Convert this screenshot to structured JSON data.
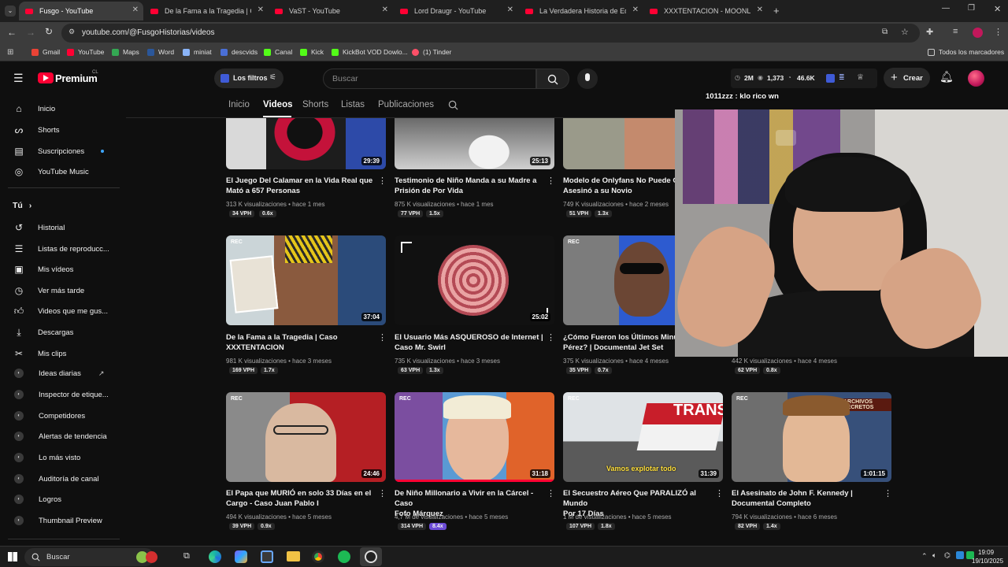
{
  "browser": {
    "tabs": [
      {
        "title": "Fusgo - YouTube",
        "active": true
      },
      {
        "title": "De la Fama a la Tragedia | Caso"
      },
      {
        "title": "VaST - YouTube"
      },
      {
        "title": "Lord Draugr - YouTube"
      },
      {
        "title": "La Verdadera Historia de Ed Ge"
      },
      {
        "title": "XXXTENTACION - MOONLIGHT"
      }
    ],
    "url": "youtube.com/@FusgoHistorias/videos",
    "bookmarks": [
      "Gmail",
      "YouTube",
      "Maps",
      "Word",
      "miniat",
      "descvids",
      "Canal",
      "Kick",
      "KickBot VOD Dowlo...",
      "(1) Tinder"
    ],
    "all_bookmarks": "Todos los marcadores"
  },
  "header": {
    "logo": "Premium",
    "country": "CL",
    "filters_label": "Los filtros",
    "search_placeholder": "Buscar",
    "stats": {
      "subs": "2M",
      "views": "1,373",
      "likes": "46.6K"
    },
    "create_label": "Crear"
  },
  "chat_overlay": "1011zzz : klo rico wn",
  "channel_tabs": [
    "Inicio",
    "Videos",
    "Shorts",
    "Listas",
    "Publicaciones"
  ],
  "sidebar": {
    "top": [
      "Inicio",
      "Shorts",
      "Suscripciones",
      "YouTube Music"
    ],
    "you_header": "Tú",
    "you": [
      "Historial",
      "Listas de reproducc...",
      "Mis vídeos",
      "Ver más tarde",
      "Videos que me gus...",
      "Descargas",
      "Mis clips"
    ],
    "ext": [
      "Ideas diarias",
      "Inspector de etique...",
      "Competidores",
      "Alertas de tendencia",
      "Lo más visto",
      "Auditoría de canal",
      "Logros",
      "Thumbnail Preview"
    ]
  },
  "videos": [
    {
      "title1": "El Juego Del Calamar en la Vida Real que",
      "title2": "Mató a 657 Personas",
      "meta": "313 K visualizaciones • hace 1 mes",
      "vph": "34 VPH",
      "mult": "0.6x",
      "dur": "29:39"
    },
    {
      "title1": "Testimonio de Niño Manda a su Madre a",
      "title2": "Prisión de Por Vida",
      "meta": "875 K visualizaciones • hace 1 mes",
      "vph": "77 VPH",
      "mult": "1.5x",
      "dur": "25:13"
    },
    {
      "title1": "Modelo de Onlyfans No Puede Cre",
      "title2": "Asesinó a su Novio",
      "meta": "749 K visualizaciones • hace 2 meses",
      "vph": "51 VPH",
      "mult": "1.3x",
      "dur": ""
    },
    {
      "title1": "De la Fama a la Tragedia | Caso",
      "title2": "XXXTENTACION",
      "meta": "981 K visualizaciones • hace 3 meses",
      "vph": "169 VPH",
      "mult": "1.7x",
      "dur": "37:04",
      "rec": "REC"
    },
    {
      "title1": "El Usuario Más ASQUEROSO de Internet |",
      "title2": "Caso Mr. Swirl",
      "meta": "735 K visualizaciones • hace 3 meses",
      "vph": "63 VPH",
      "mult": "1.3x",
      "dur": "25:02"
    },
    {
      "title1": "¿Cómo Fueron los Últimos Minuto",
      "title2": "Pérez? | Documental Jet Set",
      "meta": "375 K visualizaciones • hace 4 meses",
      "vph": "35 VPH",
      "mult": "0.7x",
      "dur": "",
      "rec": "REC"
    },
    {
      "title1": "",
      "title2": "",
      "meta": "442 K visualizaciones • hace 4 meses",
      "vph": "62 VPH",
      "mult": "0.8x",
      "dur": ""
    },
    {
      "title1": "El Papa que MURIÓ en solo 33 Días en el",
      "title2": "Cargo - Caso Juan Pablo I",
      "meta": "494 K visualizaciones • hace 5 meses",
      "vph": "39 VPH",
      "mult": "0.9x",
      "dur": "24:46",
      "rec": "REC"
    },
    {
      "title1": "De Niño Millonario a Vivir en la Cárcel - Caso",
      "title2": "Fofo Márquez",
      "meta": "4,7 M de visualizaciones • hace 5 meses",
      "vph": "314 VPH",
      "mult": "8.4x",
      "dur": "31:18",
      "rec": "REC"
    },
    {
      "title1": "El Secuestro Aéreo Que PARALIZÓ al Mundo",
      "title2": "Por 17 Días",
      "meta": "1 M de visualizaciones • hace 5 meses",
      "vph": "107 VPH",
      "mult": "1.8x",
      "dur": "31:39",
      "rec": "REC",
      "caption": "Vamos explotar todo"
    },
    {
      "title1": "El Asesinato de John F. Kennedy |",
      "title2": "Documental Completo",
      "meta": "794 K visualizaciones • hace 6 meses",
      "vph": "82 VPH",
      "mult": "1.4x",
      "dur": "1:01:15",
      "rec": "REC",
      "overlay": "ARCHIVOS SECRETOS"
    }
  ],
  "taskbar": {
    "search": "Buscar",
    "time": "19:09",
    "date": "19/10/2025"
  }
}
